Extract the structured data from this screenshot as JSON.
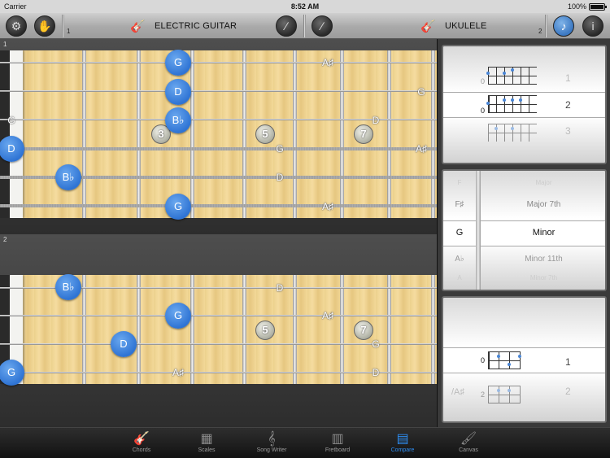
{
  "status": {
    "carrier": "Carrier",
    "time": "8:52 AM",
    "battery": "100%"
  },
  "toolbar": {
    "left_num": "1",
    "left_instrument": "ELECTRIC GUITAR",
    "right_instrument": "UKULELE",
    "right_num": "2"
  },
  "panel1": {
    "number": "1",
    "dots": [
      "G",
      "D",
      "B♭",
      "D",
      "B♭",
      "G"
    ],
    "ghosts": [
      "A♯",
      "G",
      "G",
      "D",
      "G",
      "A♯",
      "D",
      "A♯"
    ],
    "intervals": [
      "3",
      "5",
      "7"
    ]
  },
  "panel2": {
    "number": "2",
    "dots": [
      "B♭",
      "G",
      "D",
      "G"
    ],
    "ghosts": [
      "D",
      "A♯",
      "G",
      "A♯",
      "D"
    ],
    "intervals": [
      "5",
      "7"
    ]
  },
  "picker1": {
    "fret_labels": [
      "0",
      "0"
    ],
    "numbers": [
      "1",
      "2",
      "3"
    ]
  },
  "picker2": {
    "rows": [
      {
        "note": "F",
        "name": "Major"
      },
      {
        "note": "F♯",
        "name": "Major 7th"
      },
      {
        "note": "G",
        "name": "Minor"
      },
      {
        "note": "A♭",
        "name": "Minor 11th"
      },
      {
        "note": "A",
        "name": "Minor 7th"
      }
    ]
  },
  "picker3": {
    "fret_labels": [
      "0",
      "2"
    ],
    "slash": "/A♯",
    "numbers": [
      "1",
      "2"
    ]
  },
  "tabs": [
    {
      "label": "Chords",
      "icon": "guitar-headstock-icon"
    },
    {
      "label": "Scales",
      "icon": "scale-grid-icon"
    },
    {
      "label": "Song Writer",
      "icon": "treble-clef-icon"
    },
    {
      "label": "Fretboard",
      "icon": "fretboard-icon"
    },
    {
      "label": "Compare",
      "icon": "compare-icon",
      "active": true
    },
    {
      "label": "Canvas",
      "icon": "paintbrush-icon"
    }
  ],
  "colors": {
    "note_blue": "#2f74d4",
    "active_tab": "#2d8cf0"
  }
}
